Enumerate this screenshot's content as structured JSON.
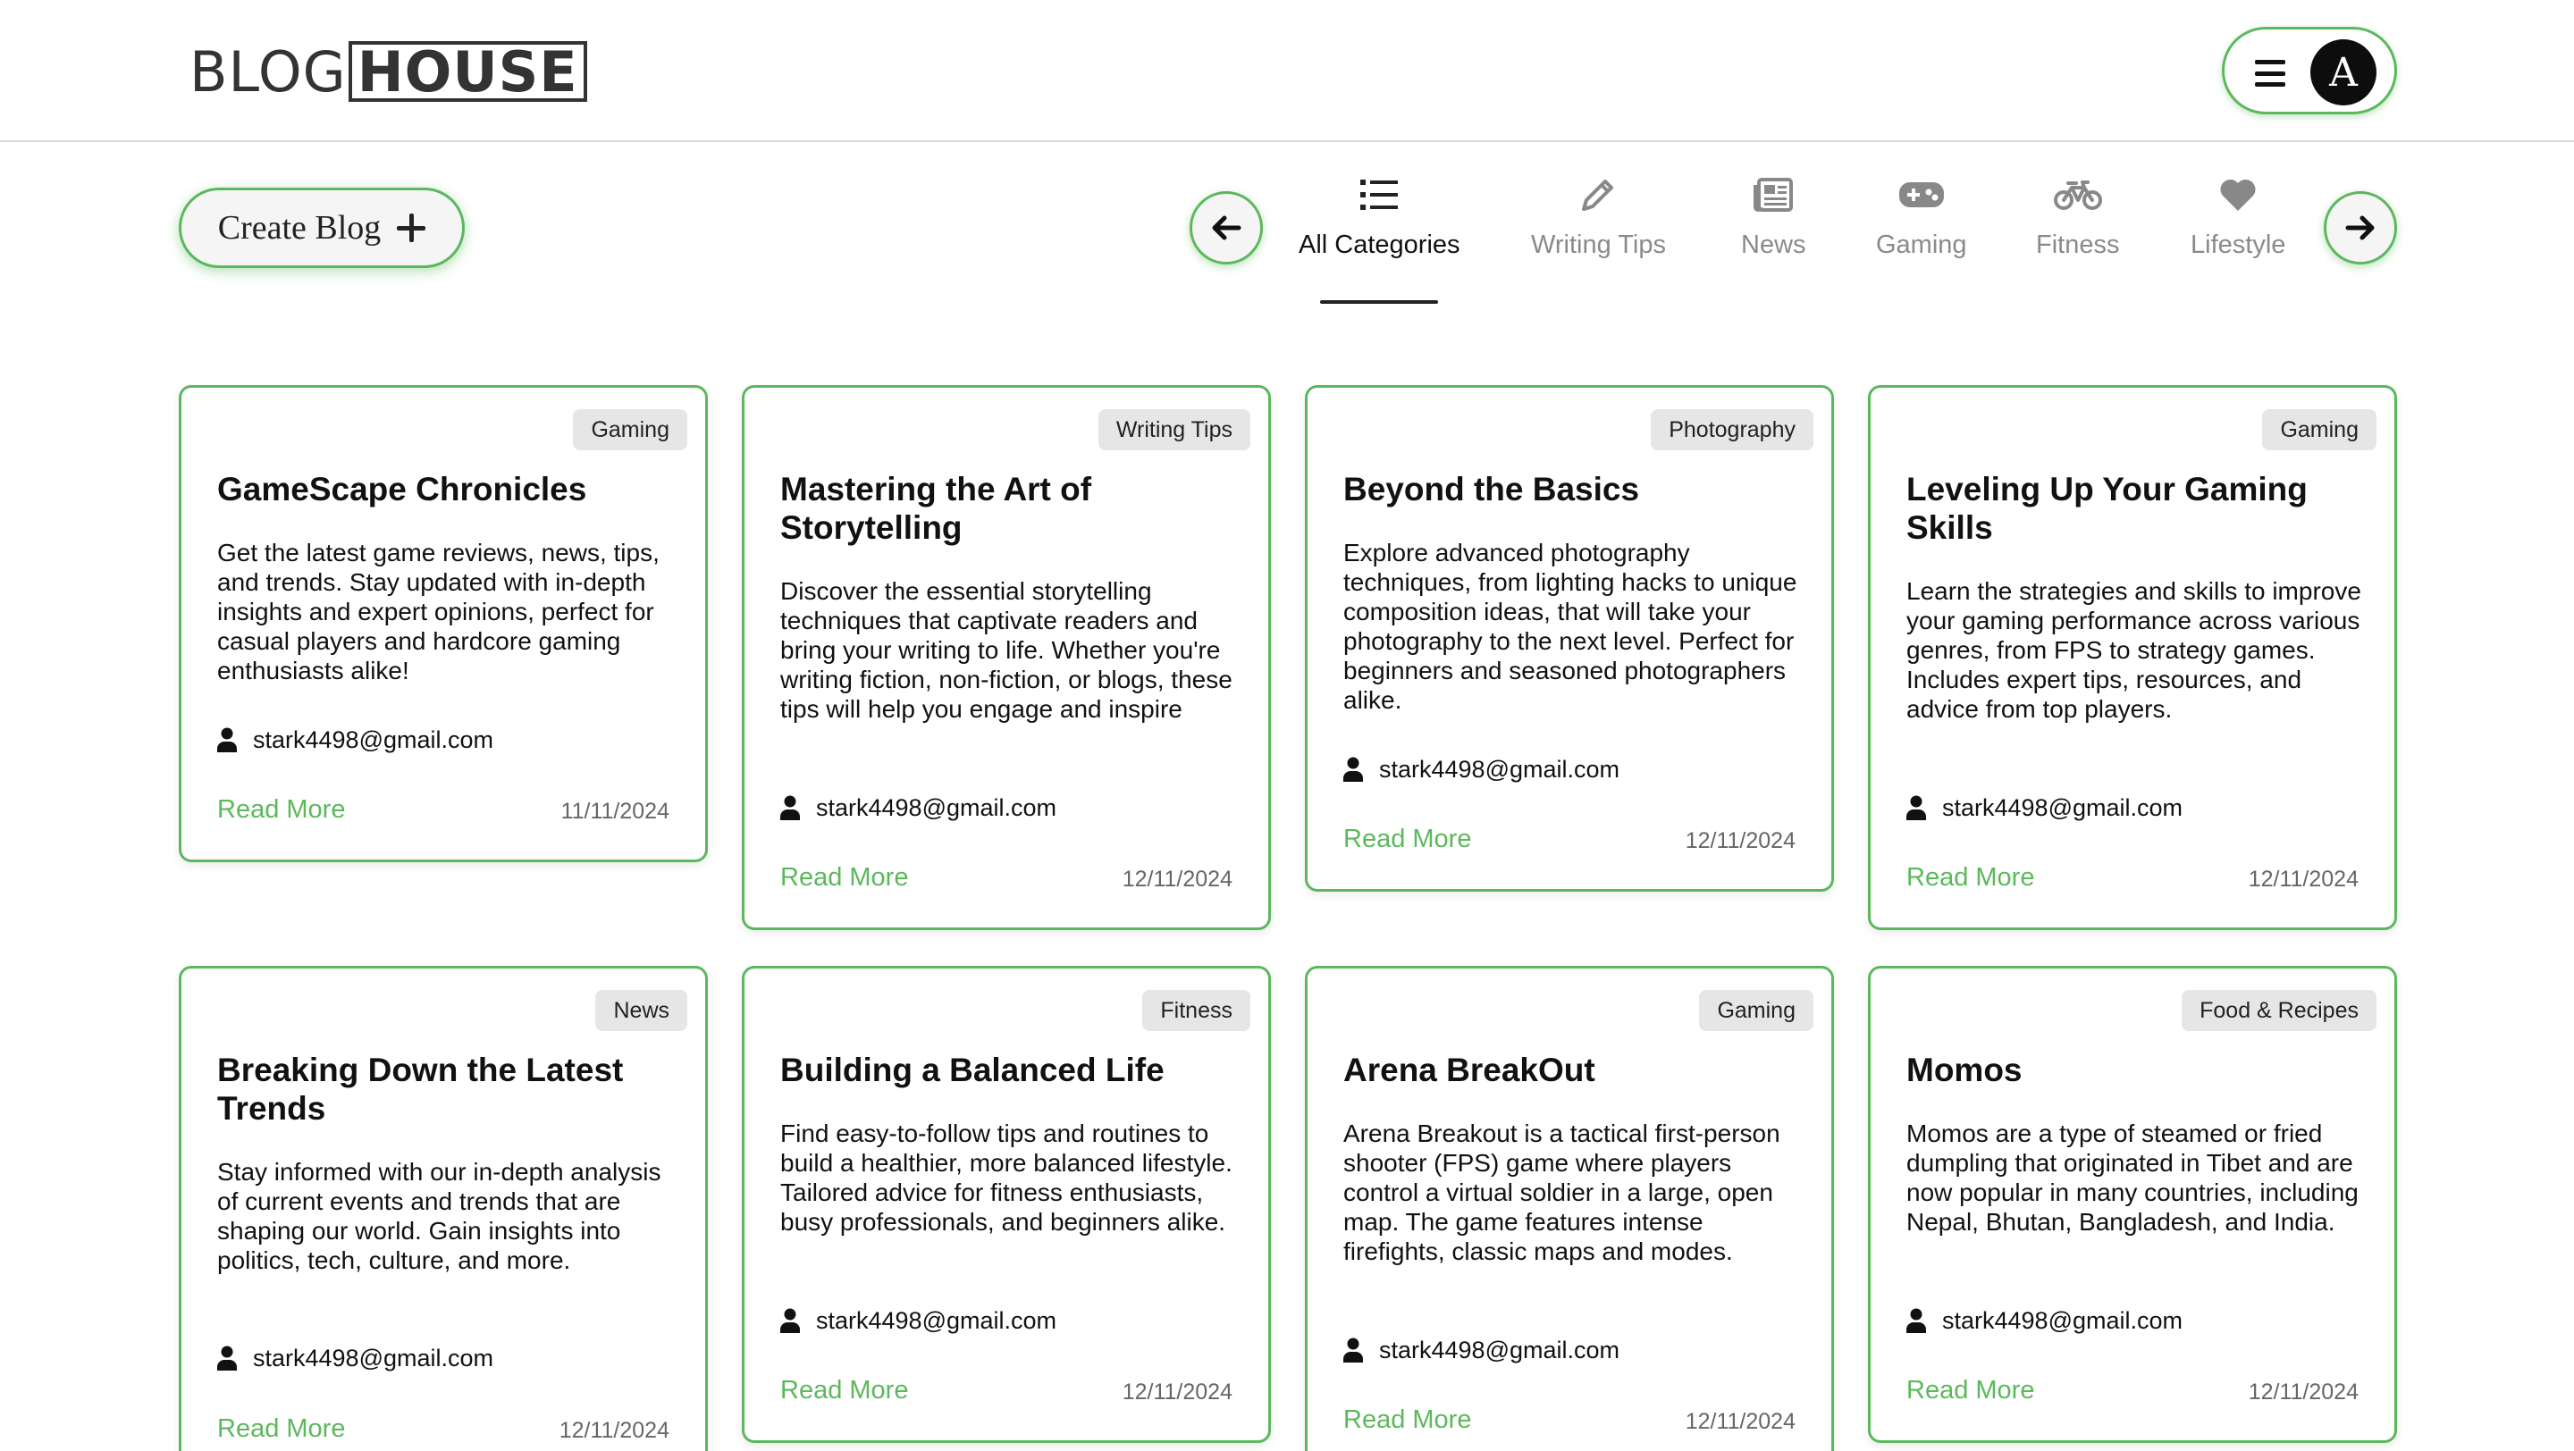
{
  "brand": {
    "logo_part1": "BLOG",
    "logo_part2": "HOUSE"
  },
  "header": {
    "avatar_letter": "A"
  },
  "toolbar": {
    "create_label": "Create Blog"
  },
  "categories": {
    "active": "All Categories",
    "tabs": [
      {
        "label": "All Categories",
        "icon": "list-icon"
      },
      {
        "label": "Writing Tips",
        "icon": "pencil-icon"
      },
      {
        "label": "News",
        "icon": "newspaper-icon"
      },
      {
        "label": "Gaming",
        "icon": "gamepad-icon"
      },
      {
        "label": "Fitness",
        "icon": "bicycle-icon"
      },
      {
        "label": "Lifestyle",
        "icon": "heart-icon"
      }
    ]
  },
  "accent_color": "#5cb85c",
  "read_more_label": "Read More",
  "posts": [
    {
      "category": "Gaming",
      "title": "GameScape Chronicles",
      "description": "Get the latest game reviews, news, tips, and trends. Stay updated with in-depth insights and expert opinions, perfect for casual players and hardcore gaming enthusiasts alike!",
      "author": "stark4498@gmail.com",
      "date": "11/11/2024"
    },
    {
      "category": "Writing Tips",
      "title": "Mastering the Art of Storytelling",
      "description": "Discover the essential storytelling techniques that captivate readers and bring your writing to life. Whether you're writing fiction, non-fiction, or blogs, these tips will help you engage and inspire",
      "author": "stark4498@gmail.com",
      "date": "12/11/2024"
    },
    {
      "category": "Photography",
      "title": "Beyond the Basics",
      "description": "Explore advanced photography techniques, from lighting hacks to unique composition ideas, that will take your photography to the next level. Perfect for beginners and seasoned photographers alike.",
      "author": "stark4498@gmail.com",
      "date": "12/11/2024"
    },
    {
      "category": "Gaming",
      "title": "Leveling Up Your Gaming Skills",
      "description": "Learn the strategies and skills to improve your gaming performance across various genres, from FPS to strategy games. Includes expert tips, resources, and advice from top players.",
      "author": "stark4498@gmail.com",
      "date": "12/11/2024"
    },
    {
      "category": "News",
      "title": "Breaking Down the Latest Trends",
      "description": "Stay informed with our in-depth analysis of current events and trends that are shaping our world. Gain insights into politics, tech, culture, and more.",
      "author": "stark4498@gmail.com",
      "date": "12/11/2024"
    },
    {
      "category": "Fitness",
      "title": "Building a Balanced Life",
      "description": "Find easy-to-follow tips and routines to build a healthier, more balanced lifestyle. Tailored advice for fitness enthusiasts, busy professionals, and beginners alike.",
      "author": "stark4498@gmail.com",
      "date": "12/11/2024"
    },
    {
      "category": "Gaming",
      "title": "Arena BreakOut",
      "description": "Arena Breakout is a tactical first-person shooter (FPS) game where players control a virtual soldier in a large, open map. The game features intense firefights, classic maps and modes.",
      "author": "stark4498@gmail.com",
      "date": "12/11/2024"
    },
    {
      "category": "Food & Recipes",
      "title": "Momos",
      "description": "Momos are a type of steamed or fried dumpling that originated in Tibet and are now popular in many countries, including Nepal, Bhutan, Bangladesh, and India.",
      "author": "stark4498@gmail.com",
      "date": "12/11/2024"
    }
  ]
}
